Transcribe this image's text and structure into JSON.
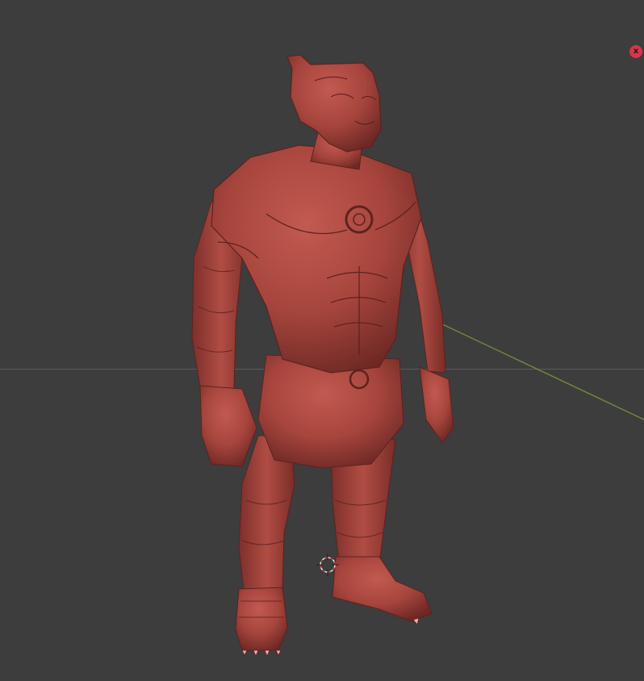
{
  "viewport": {
    "background": "#3d3d3d",
    "model_color": "#a6453d",
    "close_button": {
      "label": "x",
      "color": "#d9344a"
    },
    "icons": [
      "close-icon",
      "3d-cursor-icon"
    ]
  }
}
